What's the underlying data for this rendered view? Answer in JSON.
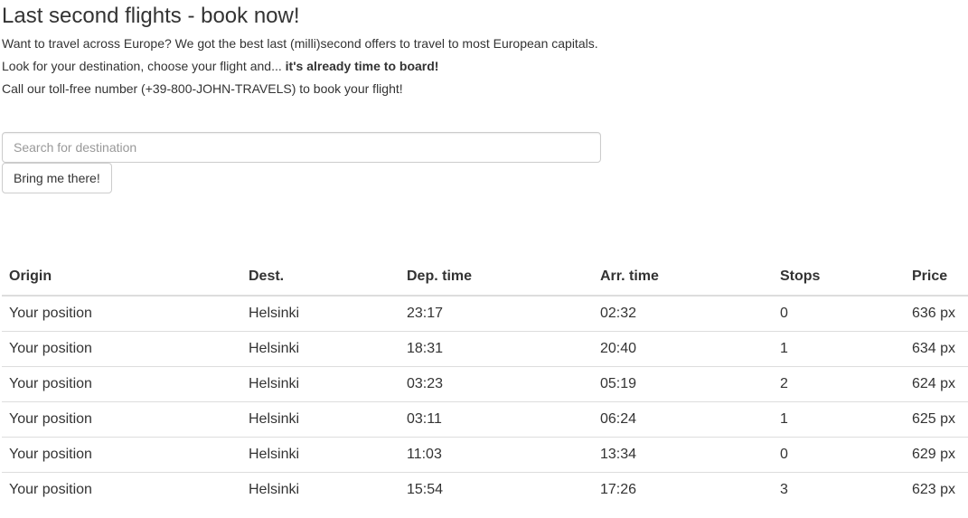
{
  "header": {
    "title": "Last second flights - book now!",
    "line1": "Want to travel across Europe? We got the best last (milli)second offers to travel to most European capitals.",
    "line2_prefix": "Look for your destination, choose your flight and... ",
    "line2_bold": "it's already time to board!",
    "line3": "Call our toll-free number (+39-800-JOHN-TRAVELS) to book your flight!"
  },
  "search": {
    "placeholder": "Search for destination",
    "value": "",
    "button_label": "Bring me there!"
  },
  "table": {
    "headers": [
      "Origin",
      "Dest.",
      "Dep. time",
      "Arr. time",
      "Stops",
      "Price"
    ],
    "rows": [
      [
        "Your position",
        "Helsinki",
        "23:17",
        "02:32",
        "0",
        "636 px"
      ],
      [
        "Your position",
        "Helsinki",
        "18:31",
        "20:40",
        "1",
        "634 px"
      ],
      [
        "Your position",
        "Helsinki",
        "03:23",
        "05:19",
        "2",
        "624 px"
      ],
      [
        "Your position",
        "Helsinki",
        "03:11",
        "06:24",
        "1",
        "625 px"
      ],
      [
        "Your position",
        "Helsinki",
        "11:03",
        "13:34",
        "0",
        "629 px"
      ],
      [
        "Your position",
        "Helsinki",
        "15:54",
        "17:26",
        "3",
        "623 px"
      ]
    ]
  },
  "colors": {
    "text": "#333333",
    "border": "#dddddd",
    "input_border": "#cccccc",
    "placeholder": "#999999"
  }
}
